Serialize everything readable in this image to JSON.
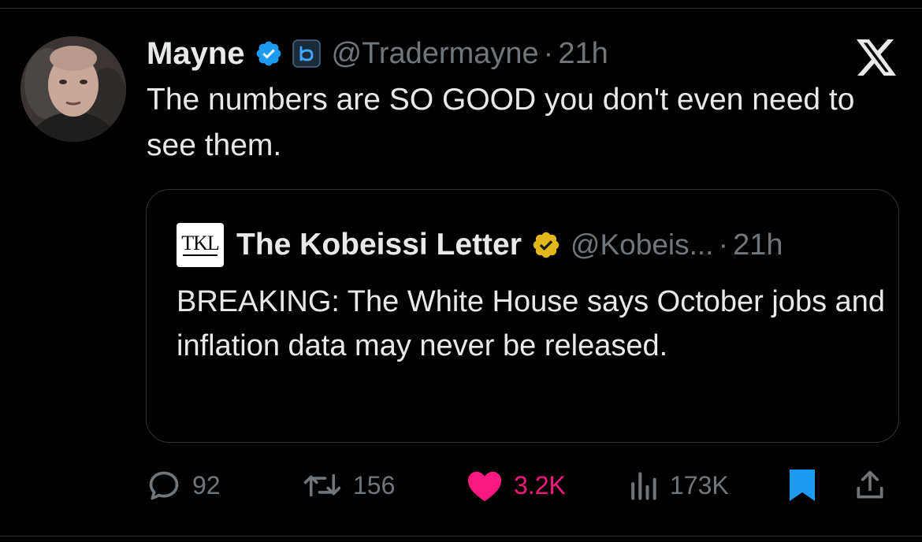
{
  "tweet": {
    "author_name": "Mayne",
    "handle": "@Tradermayne",
    "separator": "·",
    "time": "21h",
    "text": "The numbers are SO GOOD you don't even need to see them."
  },
  "quoted_tweet": {
    "logo_text": "TKL",
    "author_name": "The Kobeissi Letter",
    "handle": "@Kobeis...",
    "separator": "·",
    "time": "21h",
    "text": "BREAKING: The White House says October jobs and inflation data may never be released."
  },
  "actions": {
    "replies": "92",
    "retweets": "156",
    "likes": "3.2K",
    "views": "173K"
  },
  "colors": {
    "background": "#000000",
    "text": "#e7e9ea",
    "muted": "#71767b",
    "verified_blue": "#1d9bf0",
    "verified_gold": "#e2b719",
    "like_pink": "#f91880",
    "bookmark_blue": "#1d9bf0"
  },
  "icons": [
    "verified-blue-icon",
    "b-badge-icon",
    "x-logo-icon",
    "verified-gold-icon",
    "reply-icon",
    "retweet-icon",
    "heart-icon",
    "views-icon",
    "bookmark-icon",
    "share-icon"
  ]
}
